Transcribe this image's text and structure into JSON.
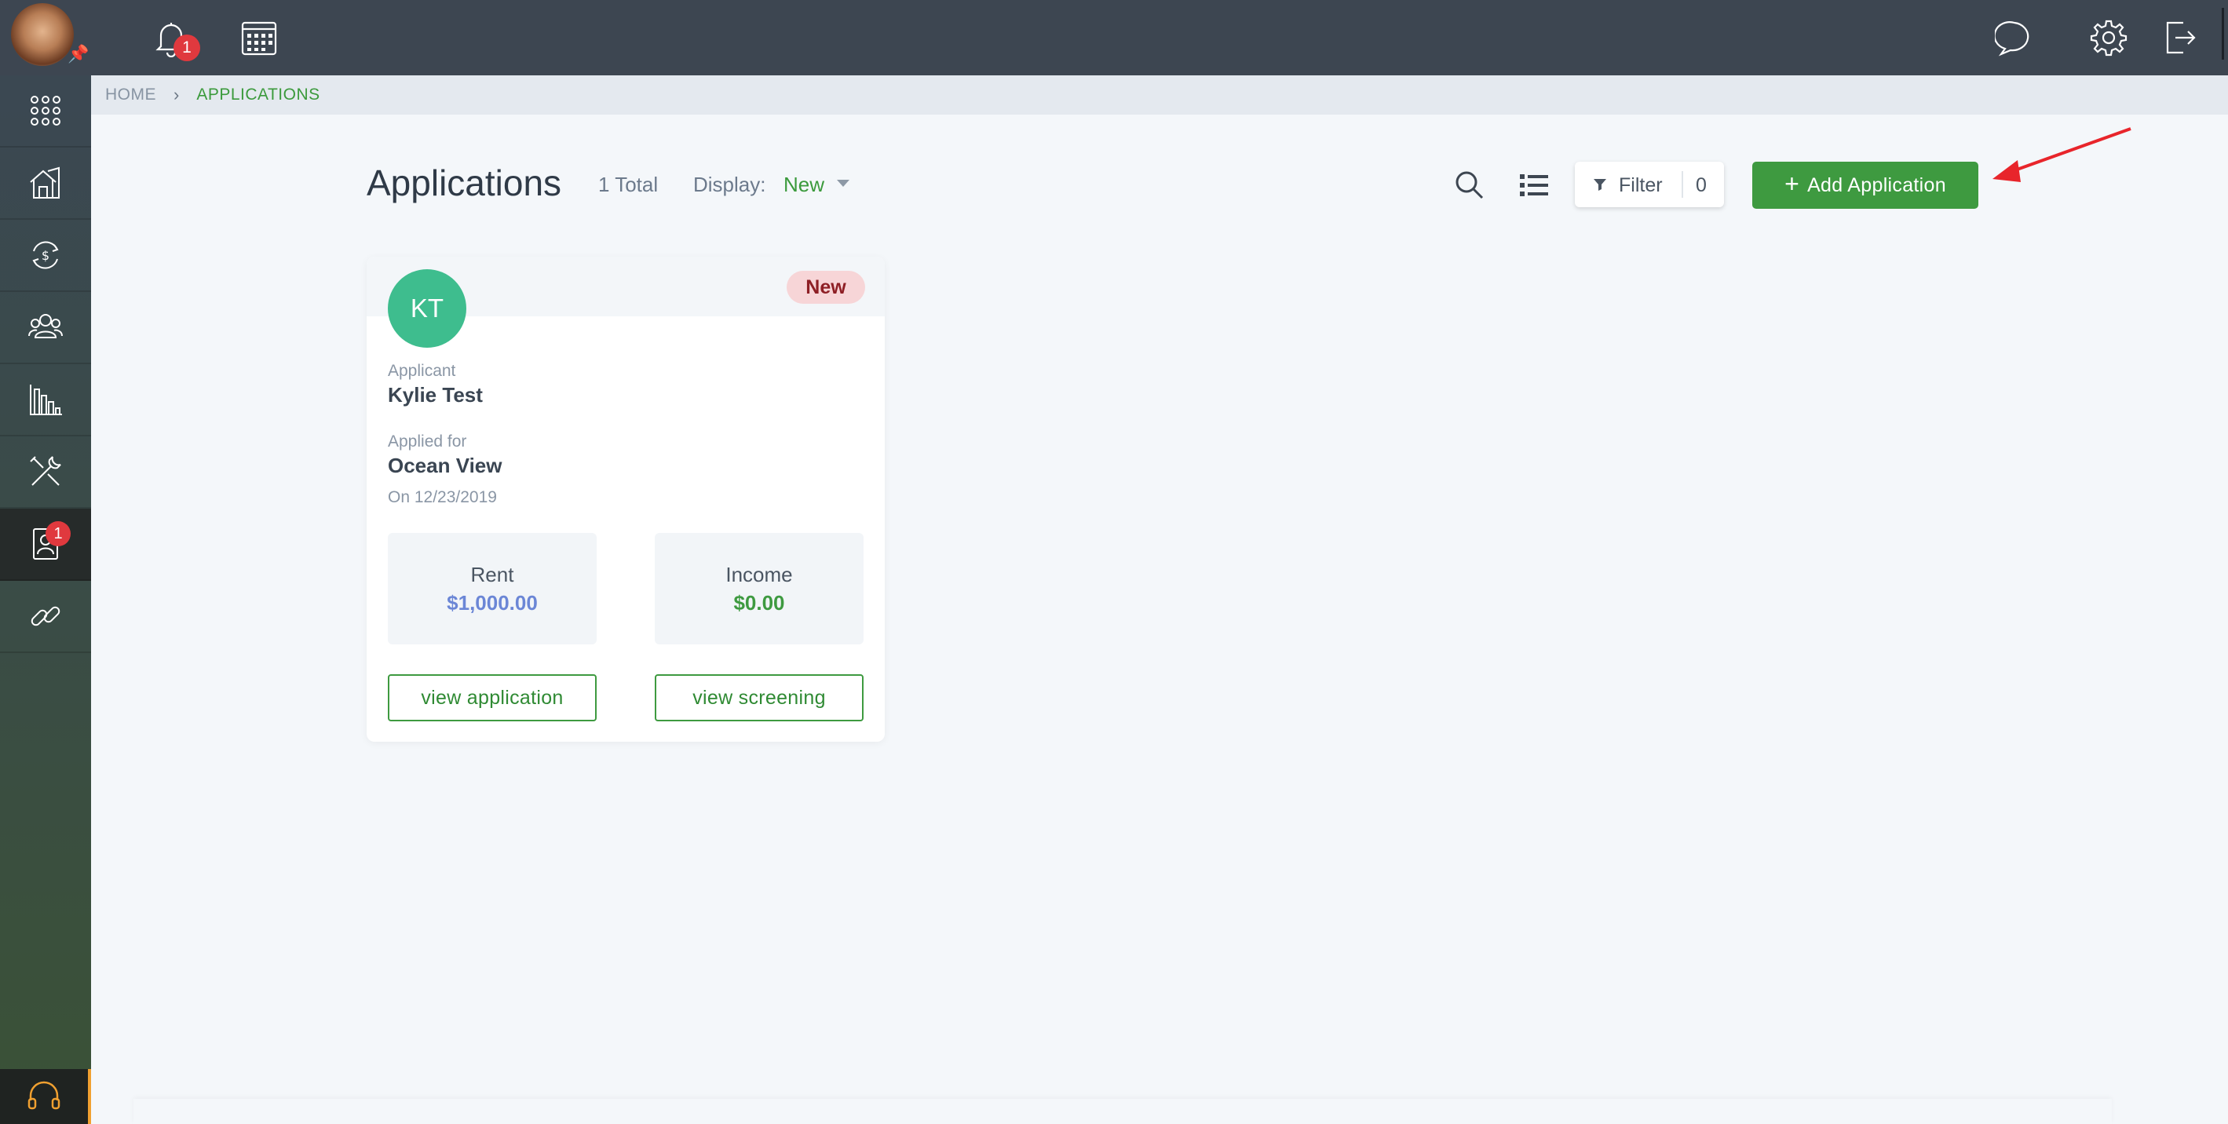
{
  "topbar": {
    "notifications_count": "1"
  },
  "sidebar": {
    "applications_badge": "1",
    "items": [
      {
        "icon": "apps-grid-icon"
      },
      {
        "icon": "home-properties-icon"
      },
      {
        "icon": "money-cycle-icon"
      },
      {
        "icon": "people-icon"
      },
      {
        "icon": "reports-chart-icon"
      },
      {
        "icon": "tools-icon"
      },
      {
        "icon": "applications-contact-icon"
      },
      {
        "icon": "link-icon"
      }
    ]
  },
  "breadcrumb": {
    "home": "HOME",
    "current": "APPLICATIONS"
  },
  "header": {
    "title": "Applications",
    "total": "1 Total",
    "display_label": "Display:",
    "display_value": "New",
    "filter_label": "Filter",
    "filter_count": "0",
    "add_label": "Add Application"
  },
  "card": {
    "initials": "KT",
    "status": "New",
    "applicant_label": "Applicant",
    "applicant_name": "Kylie Test",
    "applied_for_label": "Applied for",
    "property": "Ocean View",
    "date": "On 12/23/2019",
    "rent_label": "Rent",
    "rent_value": "$1,000.00",
    "income_label": "Income",
    "income_value": "$0.00",
    "view_application": "view application",
    "view_screening": "view screening"
  },
  "colors": {
    "accent_green": "#3e9a40",
    "rent_blue": "#6b86d6",
    "income_green": "#3e9a40",
    "badge_red": "#e0393e"
  }
}
